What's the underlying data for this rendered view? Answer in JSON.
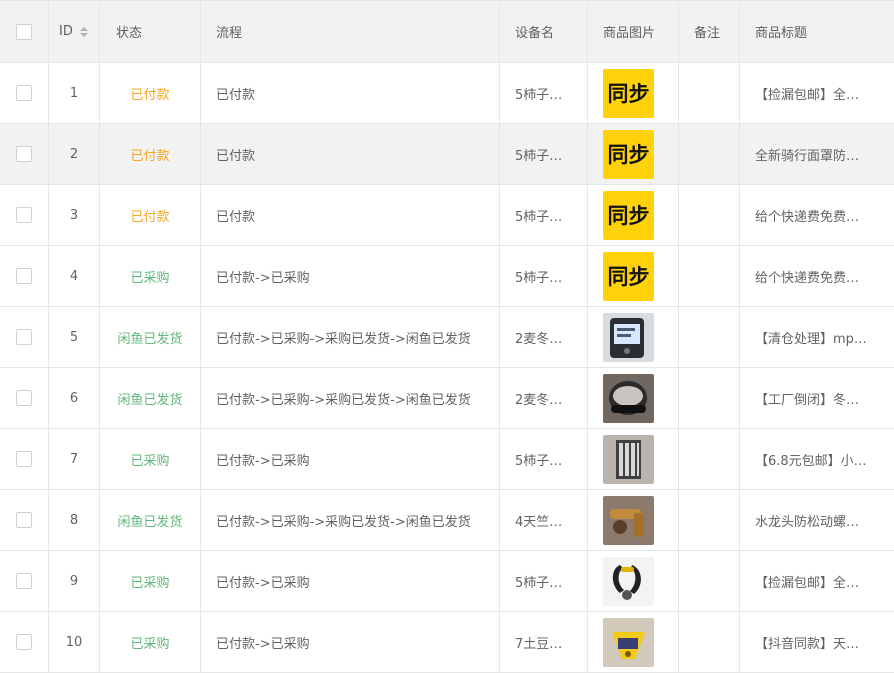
{
  "headers": {
    "id": "ID",
    "status": "状态",
    "flow": "流程",
    "device": "设备名",
    "image": "商品图片",
    "note": "备注",
    "title": "商品标题"
  },
  "rows": [
    {
      "id": "1",
      "status": "已付款",
      "flow": "已付款",
      "device": "5柿子…",
      "image": "同步",
      "title": "【捡漏包邮】全…"
    },
    {
      "id": "2",
      "status": "已付款",
      "flow": "已付款",
      "device": "5柿子…",
      "image": "同步",
      "title": "全新骑行面罩防…"
    },
    {
      "id": "3",
      "status": "已付款",
      "flow": "已付款",
      "device": "5柿子…",
      "image": "同步",
      "title": "给个快递费免费…"
    },
    {
      "id": "4",
      "status": "已采购",
      "flow": "已付款->已采购",
      "device": "5柿子…",
      "image": "同步",
      "title": "给个快递费免费…"
    },
    {
      "id": "5",
      "status": "闲鱼已发货",
      "flow": "已付款->已采购->采购已发货->闲鱼已发货",
      "device": "2麦冬…",
      "image": "device-photo",
      "title": "【清仓处理】mp…"
    },
    {
      "id": "6",
      "status": "闲鱼已发货",
      "flow": "已付款->已采购->采购已发货->闲鱼已发货",
      "device": "2麦冬…",
      "image": "helmet-photo",
      "title": "【工厂倒闭】冬…"
    },
    {
      "id": "7",
      "status": "已采购",
      "flow": "已付款->已采购",
      "device": "5柿子…",
      "image": "rack-photo",
      "title": "【6.8元包邮】小…"
    },
    {
      "id": "8",
      "status": "闲鱼已发货",
      "flow": "已付款->已采购->采购已发货->闲鱼已发货",
      "device": "4天竺…",
      "image": "faucet-photo",
      "title": "水龙头防松动螺…"
    },
    {
      "id": "9",
      "status": "已采购",
      "flow": "已付款->已采购",
      "device": "5柿子…",
      "image": "grip-photo",
      "title": "【捡漏包邮】全…"
    },
    {
      "id": "10",
      "status": "已采购",
      "flow": "已付款->已采购",
      "device": "7土豆…",
      "image": "yellow-item-photo",
      "title": "【抖音同款】天…"
    }
  ],
  "colors": {
    "paid": "#f5a623",
    "green": "#5fb878",
    "sync_bg": "#ffd20a"
  }
}
